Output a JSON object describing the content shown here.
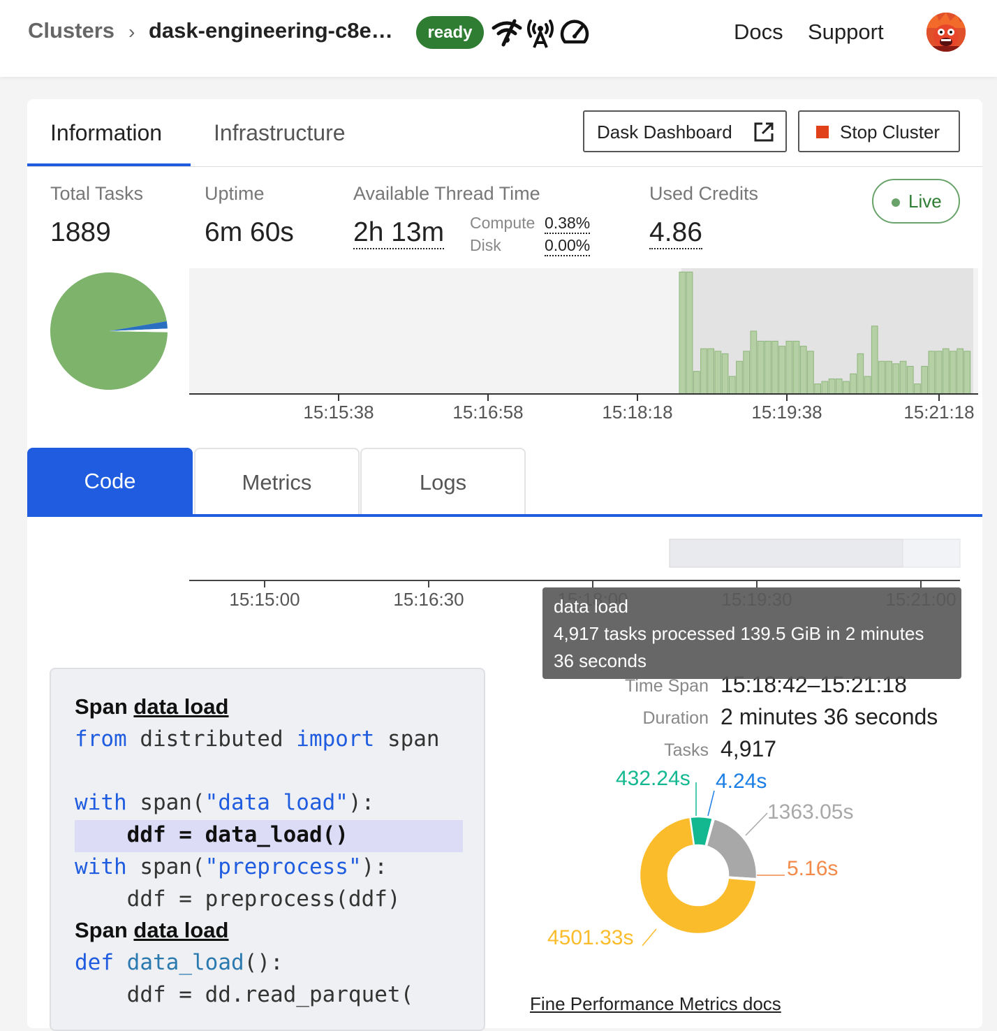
{
  "header": {
    "breadcrumb_root": "Clusters",
    "breadcrumb_sep": "›",
    "cluster_name": "dask-engineering-c8e…",
    "status_badge": "ready",
    "icons": [
      "wifi-signal-icon",
      "antenna-icon",
      "speedometer-icon"
    ],
    "nav_docs": "Docs",
    "nav_support": "Support"
  },
  "tabs": {
    "information": "Information",
    "infrastructure": "Infrastructure"
  },
  "buttons": {
    "dask_dashboard": "Dask Dashboard",
    "stop_cluster": "Stop Cluster"
  },
  "stats": {
    "total_tasks_label": "Total Tasks",
    "total_tasks": "1889",
    "uptime_label": "Uptime",
    "uptime": "6m 60s",
    "thread_time_label": "Available Thread Time",
    "thread_time": "2h 13m",
    "compute_label": "Compute",
    "compute_value": "0.38%",
    "disk_label": "Disk",
    "disk_value": "0.00%",
    "credits_label": "Used Credits",
    "credits": "4.86",
    "live_label": "Live"
  },
  "task_chart": {
    "x_ticks": [
      "15:15:38",
      "15:16:58",
      "15:18:18",
      "15:19:38",
      "15:21:18"
    ],
    "bars": [
      0.97,
      0.97,
      0.18,
      0.36,
      0.36,
      0.34,
      0.32,
      0.14,
      0.26,
      0.34,
      0.5,
      0.42,
      0.42,
      0.42,
      0.38,
      0.42,
      0.42,
      0.38,
      0.34,
      0.08,
      0.1,
      0.12,
      0.12,
      0.1,
      0.16,
      0.32,
      0.14,
      0.54,
      0.26,
      0.26,
      0.24,
      0.26,
      0.22,
      0.08,
      0.22,
      0.34,
      0.34,
      0.36,
      0.34,
      0.36,
      0.34
    ]
  },
  "pie": {
    "slices": [
      0.97,
      0.02,
      0.01
    ]
  },
  "subtabs": {
    "code": "Code",
    "metrics": "Metrics",
    "logs": "Logs"
  },
  "timeline": {
    "ticks": [
      "15:15:00",
      "15:16:30",
      "15:18:00",
      "15:19:30",
      "15:21:00"
    ]
  },
  "code": {
    "span1_prefix": "Span ",
    "span1_name": "data load",
    "line1_kw1": "from",
    "line1_a": " distributed ",
    "line1_kw2": "import",
    "line1_b": " span",
    "line2_kw": "with",
    "line2_a": " span(",
    "line2_str": "\"data load\"",
    "line2_b": "):",
    "line3": "    ddf = data_load()",
    "line4_kw": "with",
    "line4_a": " span(",
    "line4_str": "\"preprocess\"",
    "line4_b": "):",
    "line5": "    ddf = preprocess(ddf)",
    "span2_prefix": "Span ",
    "span2_name": "data load",
    "line6_kw": "def",
    "line6_fn": "data_load",
    "line6_b": "():",
    "line7": "    ddf = dd.read_parquet("
  },
  "tooltip": {
    "title": "data load",
    "body_line1": "4,917 tasks processed 139.5 GiB in 2 minutes",
    "body_line2": "36 seconds"
  },
  "details": {
    "time_span_label": "Time Span",
    "time_span": "15:18:42–15:21:18",
    "duration_label": "Duration",
    "duration": "2 minutes 36 seconds",
    "tasks_label": "Tasks",
    "tasks": "4,917"
  },
  "donut": {
    "segments": [
      {
        "label": "432.24s",
        "value": 432.24,
        "color": "#13b890"
      },
      {
        "label": "4.24s",
        "value": 4.24,
        "color": "#1a7ee6"
      },
      {
        "label": "1363.05s",
        "value": 1363.05,
        "color": "#a8a8a8"
      },
      {
        "label": "5.16s",
        "value": 5.16,
        "color": "#f28a4a"
      },
      {
        "label": "4501.33s",
        "value": 4501.33,
        "color": "#fbbc2c"
      }
    ]
  },
  "docs_link": "Fine Performance Metrics docs",
  "colors": {
    "accent": "#1f5ce0",
    "ready": "#2e7d32",
    "bar_fill": "#b5d0a4",
    "pie_main": "#7db36b"
  }
}
